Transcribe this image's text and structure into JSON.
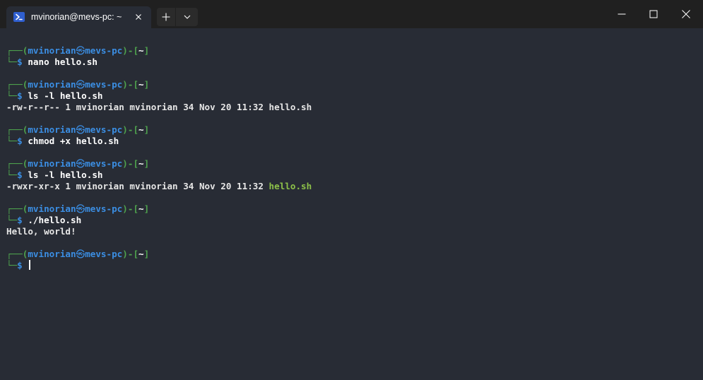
{
  "titlebar": {
    "tab_title": "mvinorian@mevs-pc: ~",
    "tab_icon": "powershell-icon",
    "close_icon": "close-icon",
    "new_tab_icon": "plus-icon",
    "dropdown_icon": "chevron-down-icon",
    "window_controls": [
      "minimize-icon",
      "maximize-icon",
      "close-icon"
    ]
  },
  "colors": {
    "background": "#282c35",
    "titlebar": "#202020",
    "frame_green": "#4ea24d",
    "prompt_blue": "#3b8ee3",
    "exec_green": "#8dc149",
    "text": "#e6e6e6"
  },
  "prompt": {
    "top_frame": "┌──",
    "open_paren": "(",
    "user": "mvinorian",
    "at": "㉿",
    "host": "mevs-pc",
    "close_paren": ")",
    "sep": "-[",
    "path": "~",
    "close_bracket": "]",
    "bottom_frame": "└─",
    "dollar": "$"
  },
  "session": [
    {
      "command": "nano hello.sh",
      "output": []
    },
    {
      "command": "ls -l hello.sh",
      "output": [
        {
          "text": "-rw-r--r-- 1 mvinorian mvinorian 34 Nov 20 11:32 ",
          "file": "hello.sh",
          "exec": false
        }
      ]
    },
    {
      "command": "chmod +x hello.sh",
      "output": []
    },
    {
      "command": "ls -l hello.sh",
      "output": [
        {
          "text": "-rwxr-xr-x 1 mvinorian mvinorian 34 Nov 20 11:32 ",
          "file": "hello.sh",
          "exec": true
        }
      ]
    },
    {
      "command": "./hello.sh",
      "output": [
        {
          "text": "Hello, world!",
          "file": "",
          "exec": false
        }
      ]
    },
    {
      "command": "",
      "output": [],
      "active": true
    }
  ]
}
